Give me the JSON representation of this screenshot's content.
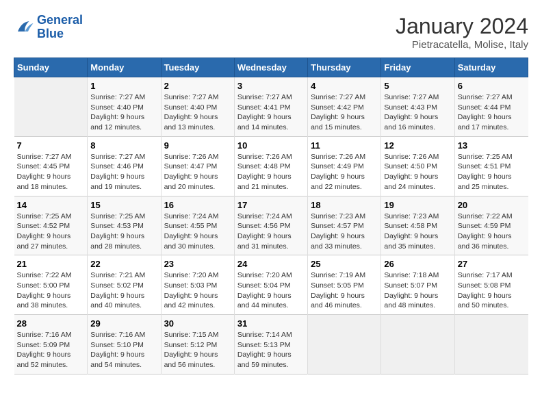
{
  "header": {
    "logo_line1": "General",
    "logo_line2": "Blue",
    "title": "January 2024",
    "subtitle": "Pietracatella, Molise, Italy"
  },
  "columns": [
    "Sunday",
    "Monday",
    "Tuesday",
    "Wednesday",
    "Thursday",
    "Friday",
    "Saturday"
  ],
  "rows": [
    [
      {
        "day": "",
        "info": ""
      },
      {
        "day": "1",
        "info": "Sunrise: 7:27 AM\nSunset: 4:40 PM\nDaylight: 9 hours and 12 minutes."
      },
      {
        "day": "2",
        "info": "Sunrise: 7:27 AM\nSunset: 4:40 PM\nDaylight: 9 hours and 13 minutes."
      },
      {
        "day": "3",
        "info": "Sunrise: 7:27 AM\nSunset: 4:41 PM\nDaylight: 9 hours and 14 minutes."
      },
      {
        "day": "4",
        "info": "Sunrise: 7:27 AM\nSunset: 4:42 PM\nDaylight: 9 hours and 15 minutes."
      },
      {
        "day": "5",
        "info": "Sunrise: 7:27 AM\nSunset: 4:43 PM\nDaylight: 9 hours and 16 minutes."
      },
      {
        "day": "6",
        "info": "Sunrise: 7:27 AM\nSunset: 4:44 PM\nDaylight: 9 hours and 17 minutes."
      }
    ],
    [
      {
        "day": "7",
        "info": "Sunrise: 7:27 AM\nSunset: 4:45 PM\nDaylight: 9 hours and 18 minutes."
      },
      {
        "day": "8",
        "info": "Sunrise: 7:27 AM\nSunset: 4:46 PM\nDaylight: 9 hours and 19 minutes."
      },
      {
        "day": "9",
        "info": "Sunrise: 7:26 AM\nSunset: 4:47 PM\nDaylight: 9 hours and 20 minutes."
      },
      {
        "day": "10",
        "info": "Sunrise: 7:26 AM\nSunset: 4:48 PM\nDaylight: 9 hours and 21 minutes."
      },
      {
        "day": "11",
        "info": "Sunrise: 7:26 AM\nSunset: 4:49 PM\nDaylight: 9 hours and 22 minutes."
      },
      {
        "day": "12",
        "info": "Sunrise: 7:26 AM\nSunset: 4:50 PM\nDaylight: 9 hours and 24 minutes."
      },
      {
        "day": "13",
        "info": "Sunrise: 7:25 AM\nSunset: 4:51 PM\nDaylight: 9 hours and 25 minutes."
      }
    ],
    [
      {
        "day": "14",
        "info": "Sunrise: 7:25 AM\nSunset: 4:52 PM\nDaylight: 9 hours and 27 minutes."
      },
      {
        "day": "15",
        "info": "Sunrise: 7:25 AM\nSunset: 4:53 PM\nDaylight: 9 hours and 28 minutes."
      },
      {
        "day": "16",
        "info": "Sunrise: 7:24 AM\nSunset: 4:55 PM\nDaylight: 9 hours and 30 minutes."
      },
      {
        "day": "17",
        "info": "Sunrise: 7:24 AM\nSunset: 4:56 PM\nDaylight: 9 hours and 31 minutes."
      },
      {
        "day": "18",
        "info": "Sunrise: 7:23 AM\nSunset: 4:57 PM\nDaylight: 9 hours and 33 minutes."
      },
      {
        "day": "19",
        "info": "Sunrise: 7:23 AM\nSunset: 4:58 PM\nDaylight: 9 hours and 35 minutes."
      },
      {
        "day": "20",
        "info": "Sunrise: 7:22 AM\nSunset: 4:59 PM\nDaylight: 9 hours and 36 minutes."
      }
    ],
    [
      {
        "day": "21",
        "info": "Sunrise: 7:22 AM\nSunset: 5:00 PM\nDaylight: 9 hours and 38 minutes."
      },
      {
        "day": "22",
        "info": "Sunrise: 7:21 AM\nSunset: 5:02 PM\nDaylight: 9 hours and 40 minutes."
      },
      {
        "day": "23",
        "info": "Sunrise: 7:20 AM\nSunset: 5:03 PM\nDaylight: 9 hours and 42 minutes."
      },
      {
        "day": "24",
        "info": "Sunrise: 7:20 AM\nSunset: 5:04 PM\nDaylight: 9 hours and 44 minutes."
      },
      {
        "day": "25",
        "info": "Sunrise: 7:19 AM\nSunset: 5:05 PM\nDaylight: 9 hours and 46 minutes."
      },
      {
        "day": "26",
        "info": "Sunrise: 7:18 AM\nSunset: 5:07 PM\nDaylight: 9 hours and 48 minutes."
      },
      {
        "day": "27",
        "info": "Sunrise: 7:17 AM\nSunset: 5:08 PM\nDaylight: 9 hours and 50 minutes."
      }
    ],
    [
      {
        "day": "28",
        "info": "Sunrise: 7:16 AM\nSunset: 5:09 PM\nDaylight: 9 hours and 52 minutes."
      },
      {
        "day": "29",
        "info": "Sunrise: 7:16 AM\nSunset: 5:10 PM\nDaylight: 9 hours and 54 minutes."
      },
      {
        "day": "30",
        "info": "Sunrise: 7:15 AM\nSunset: 5:12 PM\nDaylight: 9 hours and 56 minutes."
      },
      {
        "day": "31",
        "info": "Sunrise: 7:14 AM\nSunset: 5:13 PM\nDaylight: 9 hours and 59 minutes."
      },
      {
        "day": "",
        "info": ""
      },
      {
        "day": "",
        "info": ""
      },
      {
        "day": "",
        "info": ""
      }
    ]
  ]
}
